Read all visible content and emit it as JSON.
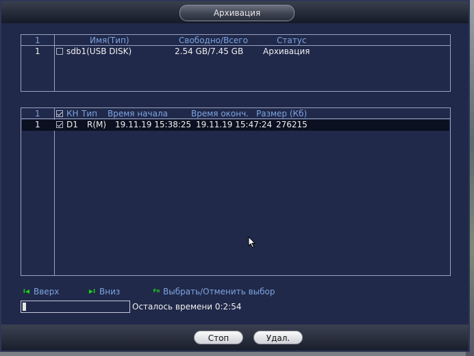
{
  "window": {
    "title": "Архивация"
  },
  "devices": {
    "headers": {
      "index": "1",
      "name": "Имя(Тип)",
      "free_total": "Свободно/Всего",
      "status": "Статус"
    },
    "rows": [
      {
        "index": "1",
        "checked": false,
        "name": "sdb1(USB DISK)",
        "free_total": "2.54 GB/7.45 GB",
        "status": "Архивация"
      }
    ]
  },
  "files": {
    "headers": {
      "index": "1",
      "channel": "КН",
      "type": "Тип",
      "start": "Время начала",
      "end": "Время оконч.",
      "size": "Размер (Кб)"
    },
    "rows": [
      {
        "index": "1",
        "checked": true,
        "channel": "D1",
        "type": "R(M)",
        "start": "19.11.19 15:38:25",
        "end": "19.11.19 15:47:24",
        "size": "276215"
      }
    ]
  },
  "navigation": {
    "up": {
      "icon": "page-up-icon",
      "glyph": "I◀",
      "label": "Вверх"
    },
    "down": {
      "icon": "page-down-icon",
      "glyph": "▶I",
      "label": "Вниз"
    },
    "select": {
      "icon": "fn-key-icon",
      "glyph": "Fn",
      "label": "Выбрать/Отменить выбор"
    }
  },
  "progress": {
    "fraction": 0.03,
    "remaining_text": "Осталось времени 0:2:54"
  },
  "buttons": {
    "stop": "Стоп",
    "delete": "Удал."
  },
  "colors": {
    "window_bg": "#20294a",
    "header_text": "#7fa4e0",
    "nav_icon": "#1bd01b"
  }
}
